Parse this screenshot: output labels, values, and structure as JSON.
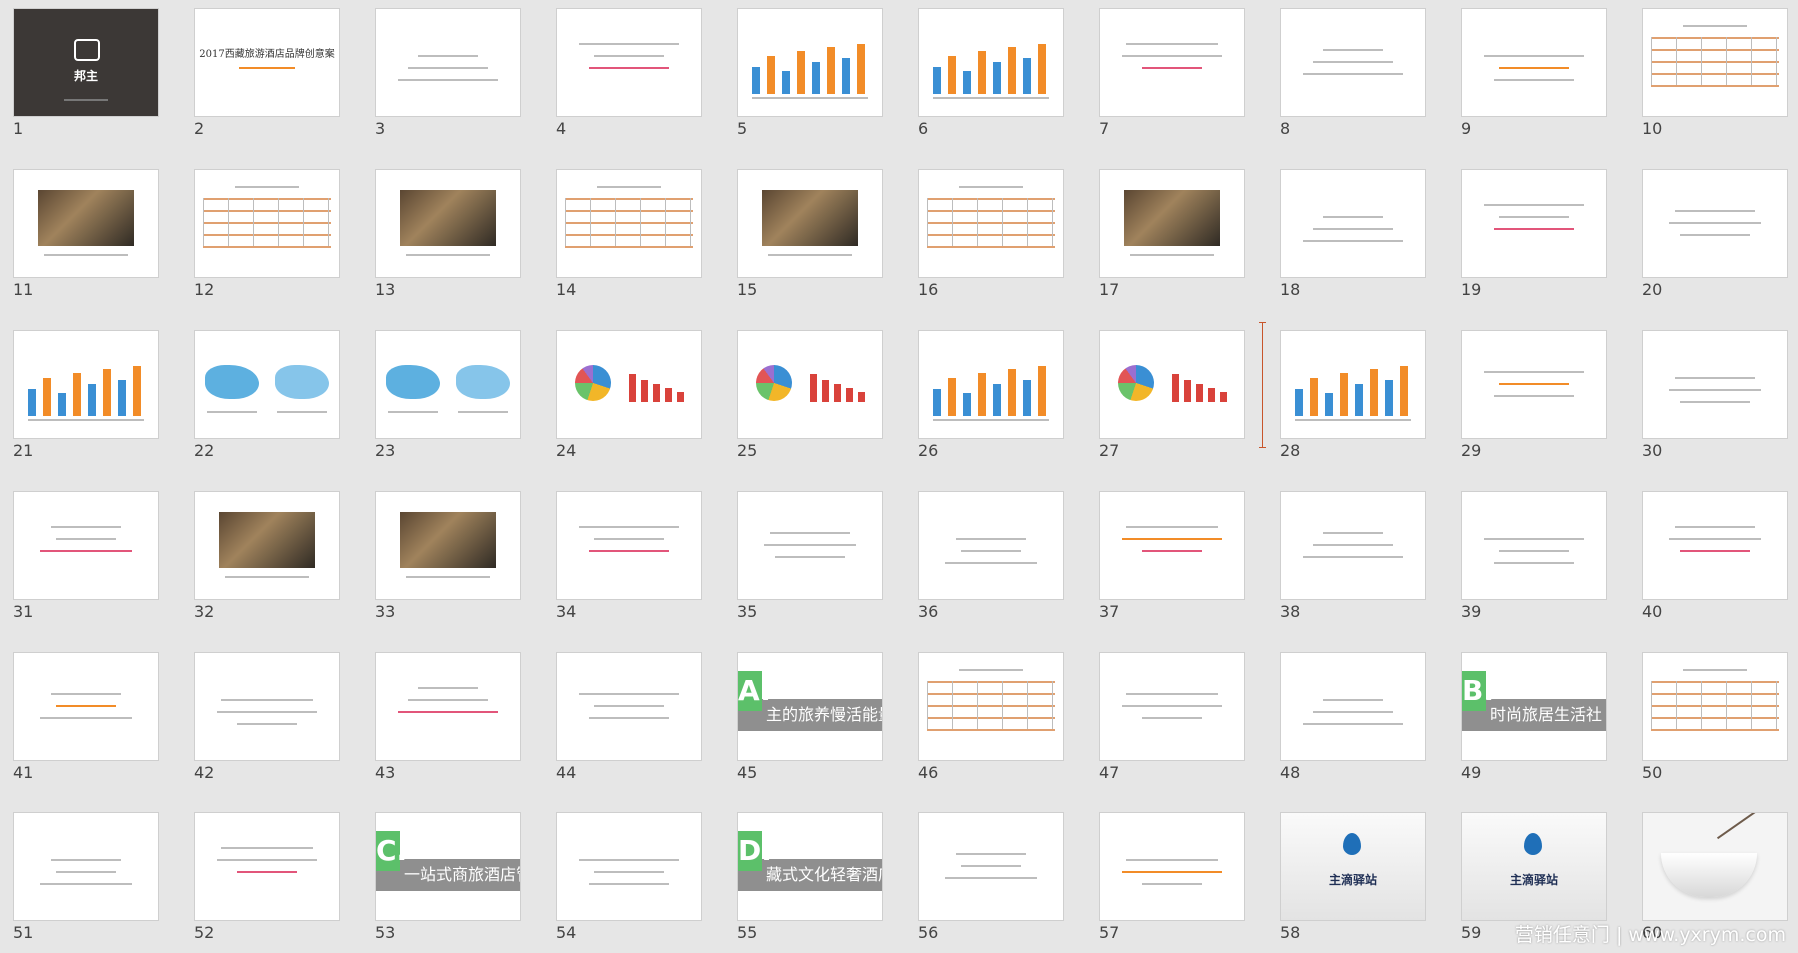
{
  "app": {
    "view": "slide-sorter"
  },
  "slides": [
    {
      "n": "1",
      "kind": "cover",
      "logo_text": "邦主"
    },
    {
      "n": "2",
      "kind": "title",
      "title": "2017西藏旅游酒店品牌创意案"
    },
    {
      "n": "3",
      "kind": "text"
    },
    {
      "n": "4",
      "kind": "text"
    },
    {
      "n": "5",
      "kind": "chart"
    },
    {
      "n": "6",
      "kind": "chart"
    },
    {
      "n": "7",
      "kind": "text"
    },
    {
      "n": "8",
      "kind": "text"
    },
    {
      "n": "9",
      "kind": "text"
    },
    {
      "n": "10",
      "kind": "table"
    },
    {
      "n": "11",
      "kind": "photo"
    },
    {
      "n": "12",
      "kind": "table"
    },
    {
      "n": "13",
      "kind": "photo"
    },
    {
      "n": "14",
      "kind": "table"
    },
    {
      "n": "15",
      "kind": "photo"
    },
    {
      "n": "16",
      "kind": "table"
    },
    {
      "n": "17",
      "kind": "photo"
    },
    {
      "n": "18",
      "kind": "text"
    },
    {
      "n": "19",
      "kind": "text"
    },
    {
      "n": "20",
      "kind": "text"
    },
    {
      "n": "21",
      "kind": "chart"
    },
    {
      "n": "22",
      "kind": "map"
    },
    {
      "n": "23",
      "kind": "map"
    },
    {
      "n": "24",
      "kind": "pie"
    },
    {
      "n": "25",
      "kind": "pie"
    },
    {
      "n": "26",
      "kind": "chart"
    },
    {
      "n": "27",
      "kind": "pie"
    },
    {
      "n": "28",
      "kind": "chart"
    },
    {
      "n": "29",
      "kind": "text"
    },
    {
      "n": "30",
      "kind": "text"
    },
    {
      "n": "31",
      "kind": "text"
    },
    {
      "n": "32",
      "kind": "photo"
    },
    {
      "n": "33",
      "kind": "photo"
    },
    {
      "n": "34",
      "kind": "text"
    },
    {
      "n": "35",
      "kind": "text"
    },
    {
      "n": "36",
      "kind": "text"
    },
    {
      "n": "37",
      "kind": "text"
    },
    {
      "n": "38",
      "kind": "text"
    },
    {
      "n": "39",
      "kind": "text"
    },
    {
      "n": "40",
      "kind": "text"
    },
    {
      "n": "41",
      "kind": "text"
    },
    {
      "n": "42",
      "kind": "text"
    },
    {
      "n": "43",
      "kind": "text"
    },
    {
      "n": "44",
      "kind": "text"
    },
    {
      "n": "45",
      "kind": "section",
      "letter": "A.",
      "title": "主的旅养慢活能量驿"
    },
    {
      "n": "46",
      "kind": "table"
    },
    {
      "n": "47",
      "kind": "text"
    },
    {
      "n": "48",
      "kind": "text"
    },
    {
      "n": "49",
      "kind": "section",
      "letter": "B.",
      "title": "时尚旅居生活社"
    },
    {
      "n": "50",
      "kind": "table"
    },
    {
      "n": "51",
      "kind": "text"
    },
    {
      "n": "52",
      "kind": "text"
    },
    {
      "n": "53",
      "kind": "section",
      "letter": "C.",
      "title": "一站式商旅酒店管"
    },
    {
      "n": "54",
      "kind": "text"
    },
    {
      "n": "55",
      "kind": "section",
      "letter": "D.",
      "title": "藏式文化轻奢酒店"
    },
    {
      "n": "56",
      "kind": "text"
    },
    {
      "n": "57",
      "kind": "text"
    },
    {
      "n": "58",
      "kind": "logo",
      "logo_text": "主滴驿站"
    },
    {
      "n": "59",
      "kind": "logo",
      "logo_text": "主滴驿站"
    },
    {
      "n": "60",
      "kind": "bowl"
    }
  ],
  "watermark": "营销任意门 | www.yxrym.com",
  "colors": {
    "accent": "#f28c28",
    "cover": "#3c3836",
    "section_tab": "#5cc06a"
  }
}
